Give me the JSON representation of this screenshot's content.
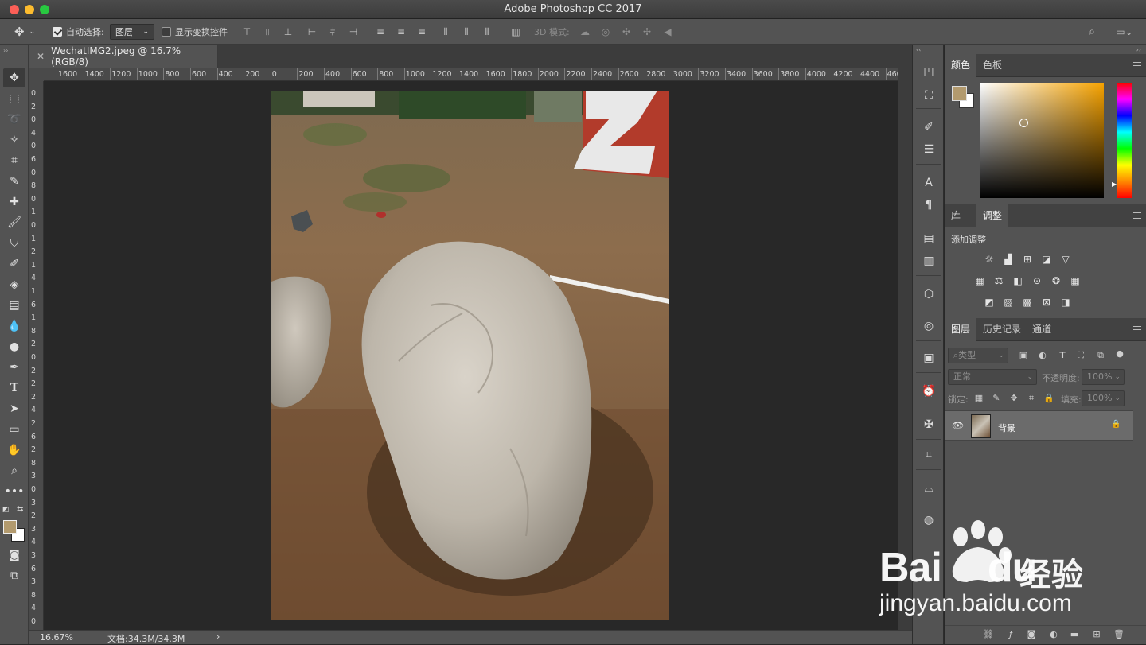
{
  "window": {
    "title": "Adobe Photoshop CC 2017"
  },
  "options": {
    "auto_select_label": "自动选择:",
    "auto_select_target": "图层",
    "show_transform_label": "显示变换控件",
    "mode_3d_label": "3D 模式:"
  },
  "document": {
    "tab_title": "WechatIMG2.jpeg @ 16.7%(RGB/8)",
    "zoom": "16.67%",
    "doc_size": "文档:34.3M/34.3M"
  },
  "ruler": {
    "h_ticks": [
      "1600",
      "1400",
      "1200",
      "1000",
      "800",
      "600",
      "400",
      "200",
      "0",
      "200",
      "400",
      "600",
      "800",
      "1000",
      "1200",
      "1400",
      "1600",
      "1800",
      "2000",
      "2200",
      "2400",
      "2600",
      "2800",
      "3000",
      "3200",
      "3400",
      "3600",
      "3800",
      "4000",
      "4200",
      "4400",
      "460"
    ],
    "v_digits": [
      "0",
      "2",
      "0",
      "4",
      "0",
      "6",
      "0",
      "8",
      "0",
      "1",
      "0",
      "1",
      "2",
      "1",
      "4",
      "1",
      "6",
      "1",
      "8",
      "2",
      "0",
      "2",
      "2",
      "2",
      "4",
      "2",
      "6",
      "2",
      "8",
      "3",
      "0",
      "3",
      "2",
      "3",
      "4",
      "3",
      "6",
      "3",
      "8",
      "4",
      "0"
    ]
  },
  "panels": {
    "color": {
      "tab_color": "颜色",
      "tab_swatches": "色板",
      "foreground": "#b29a6e",
      "background": "#ffffff"
    },
    "adjust": {
      "tab_library": "库",
      "tab_adjust": "调整",
      "add_label": "添加调整"
    },
    "layers": {
      "tab_layers": "图层",
      "tab_history": "历史记录",
      "tab_channels": "通道",
      "filter_label": "类型",
      "blend_mode": "正常",
      "opacity_label": "不透明度:",
      "opacity_value": "100%",
      "lock_label": "锁定:",
      "fill_label": "填充:",
      "fill_value": "100%",
      "layer_name": "背景"
    }
  },
  "watermark": {
    "brand_text": "Bai",
    "brand_du": "du",
    "brand_cn": "经验",
    "url": "jingyan.baidu.com"
  }
}
